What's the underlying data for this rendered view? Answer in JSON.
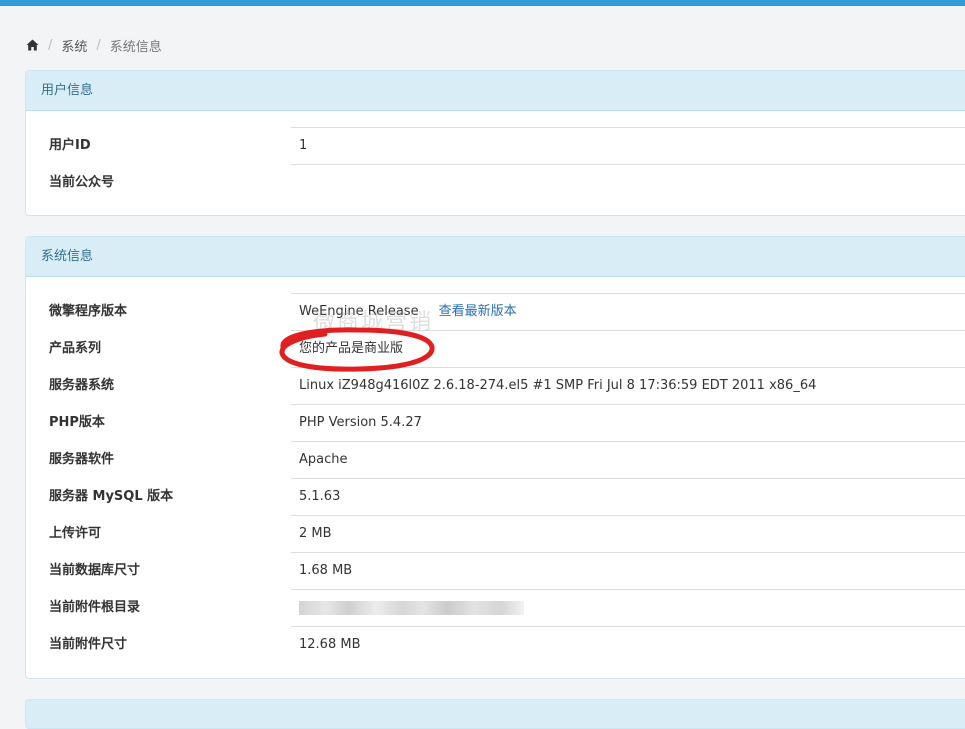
{
  "breadcrumb": {
    "home_icon": "home-icon",
    "item1": "系统",
    "item2": "系统信息"
  },
  "user_panel": {
    "title": "用户信息",
    "rows": [
      {
        "label": "用户ID",
        "value": "1"
      },
      {
        "label": "当前公众号",
        "value": ""
      }
    ]
  },
  "system_panel": {
    "title": "系统信息",
    "rows": [
      {
        "label": "微擎程序版本",
        "value": "WeEngine Release",
        "link": "查看最新版本"
      },
      {
        "label": "产品系列",
        "value": "您的产品是商业版"
      },
      {
        "label": "服务器系统",
        "value": "Linux iZ948g416l0Z 2.6.18-274.el5 #1 SMP Fri Jul 8 17:36:59 EDT 2011 x86_64"
      },
      {
        "label": "PHP版本",
        "value": "PHP Version 5.4.27"
      },
      {
        "label": "服务器软件",
        "value": "Apache"
      },
      {
        "label": "服务器 MySQL 版本",
        "value": "5.1.63"
      },
      {
        "label": "上传许可",
        "value": "2 MB"
      },
      {
        "label": "当前数据库尺寸",
        "value": "1.68 MB"
      },
      {
        "label": "当前附件根目录",
        "value": ""
      },
      {
        "label": "当前附件尺寸",
        "value": "12.68 MB"
      }
    ]
  },
  "watermark": "微商城营销",
  "colors": {
    "accent": "#2f9bd8",
    "panel_heading_bg": "#d9edf7",
    "panel_heading_text": "#31708f",
    "link": "#2a6fb5",
    "highlight": "#e02020"
  }
}
